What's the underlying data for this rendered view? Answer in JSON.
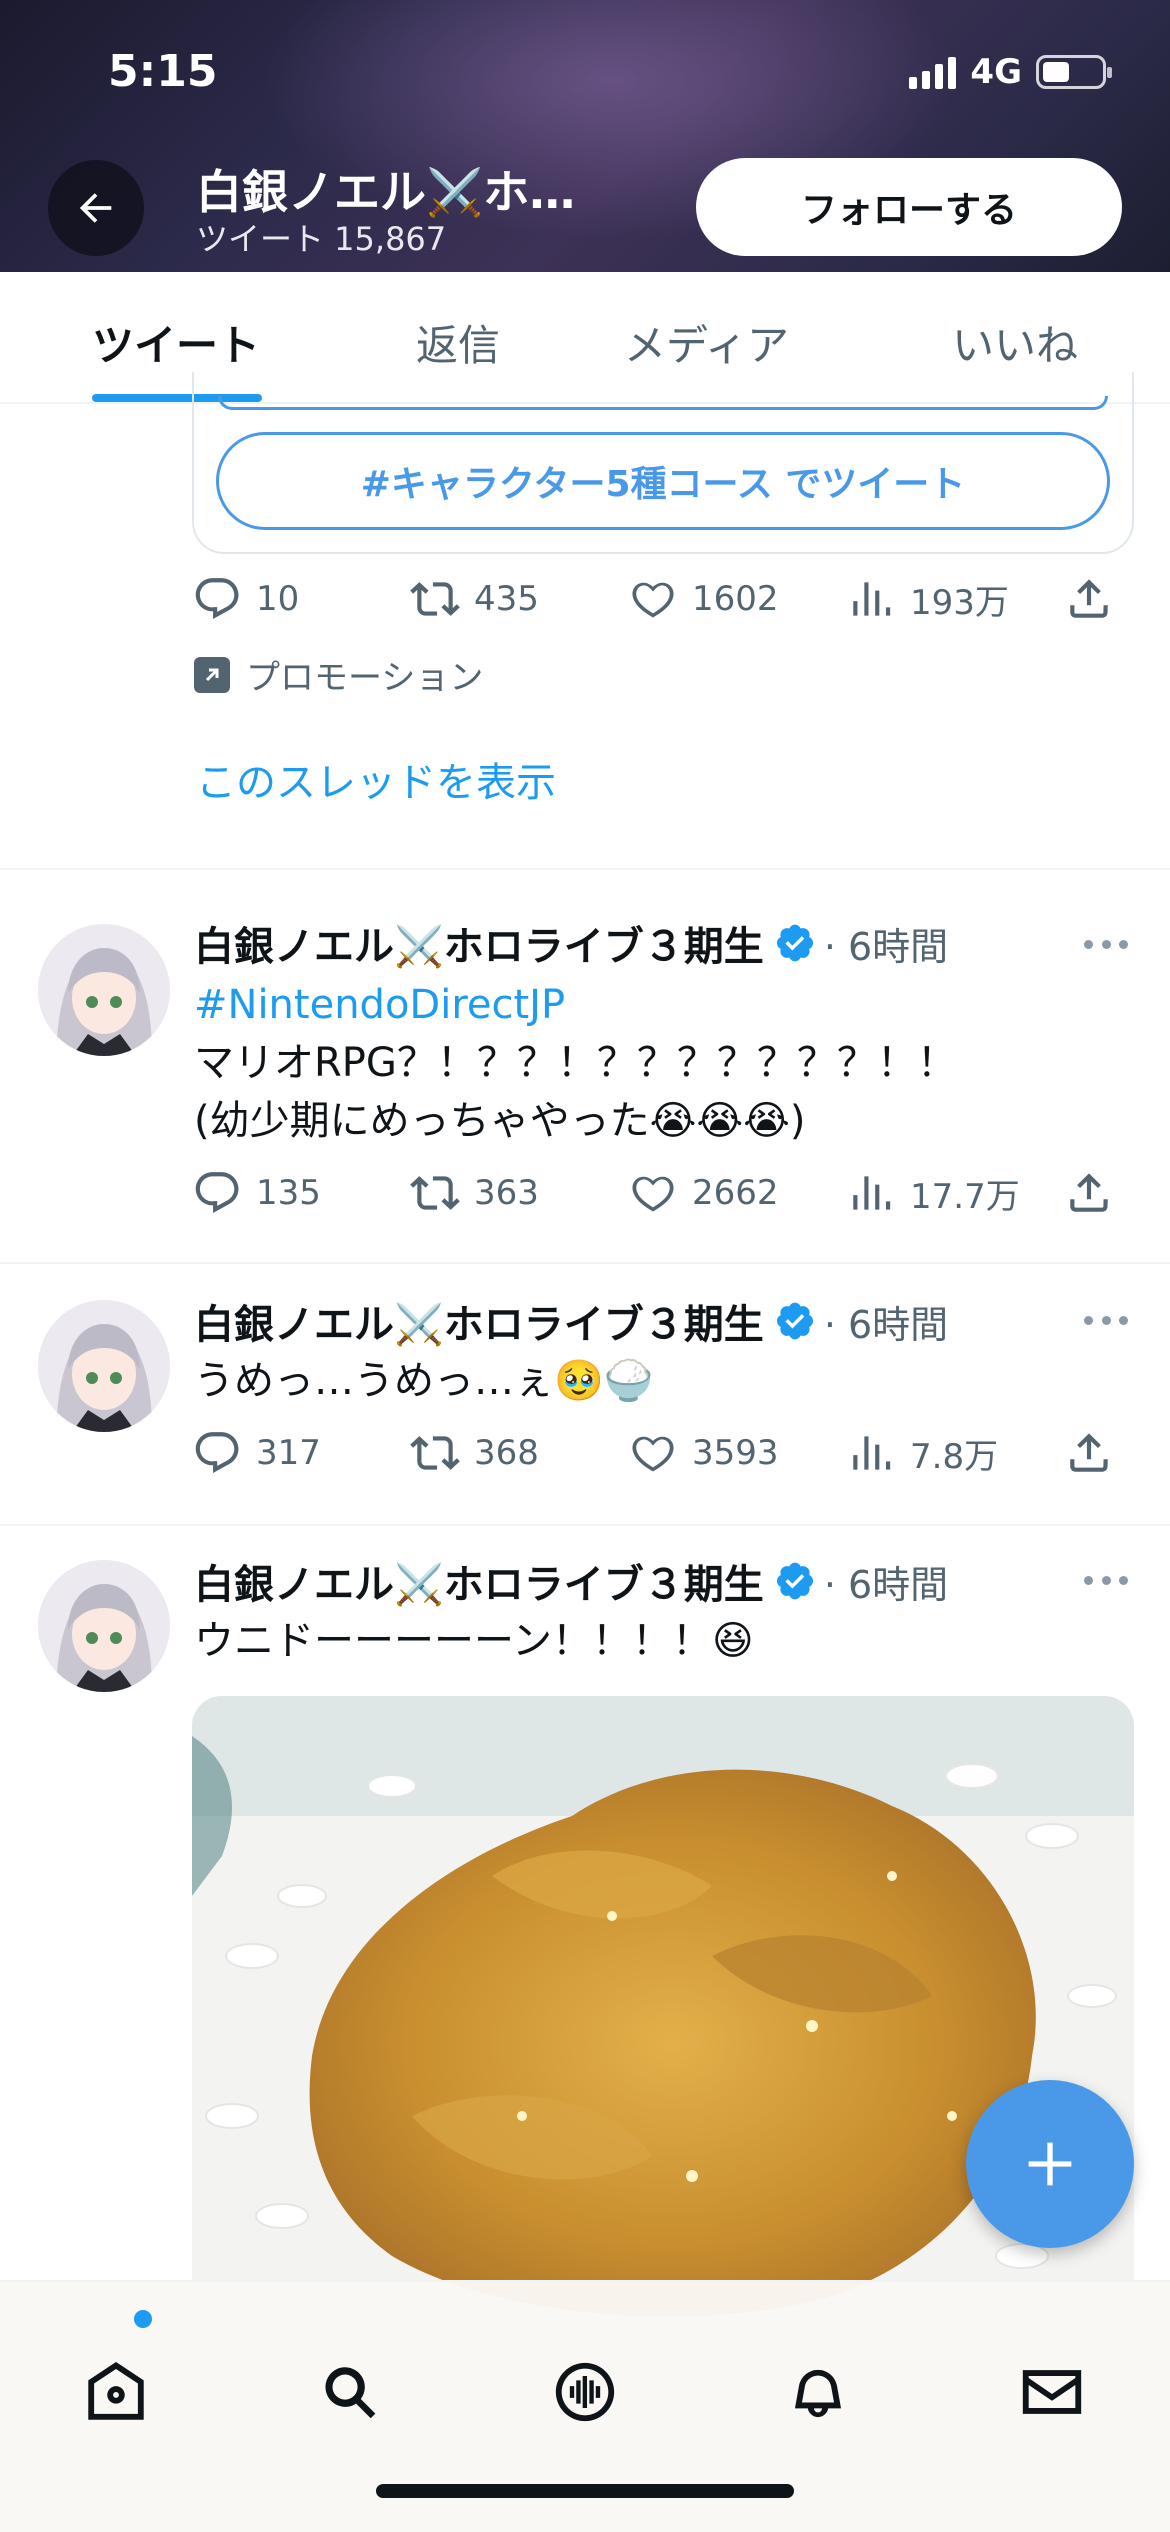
{
  "status_bar": {
    "time": "5:15",
    "network": "4G"
  },
  "header": {
    "name": "白銀ノエル⚔️ホ…",
    "tweet_count": "ツイート 15,867",
    "follow_label": "フォローする"
  },
  "tabs": [
    "ツイート",
    "返信",
    "メディア",
    "いいね"
  ],
  "promo": {
    "hashtag_button": "#キャラクター5種コース でツイート",
    "stats": {
      "replies": "10",
      "retweets": "435",
      "likes": "1602",
      "views": "193万"
    },
    "promotion_label": "プロモーション",
    "show_thread": "このスレッドを表示"
  },
  "tweets": [
    {
      "name": "白銀ノエル⚔️ホロライブ３期生",
      "time": "· 6時間",
      "hashtag": "#NintendoDirectJP",
      "line1": "マリオRPG？！？？！？？？？？？？！！",
      "line2": "(幼少期にめっちゃやった😭😭😭)",
      "stats": {
        "replies": "135",
        "retweets": "363",
        "likes": "2662",
        "views": "17.7万"
      }
    },
    {
      "name": "白銀ノエル⚔️ホロライブ３期生",
      "time": "· 6時間",
      "line1": "うめっ…うめっ…ぇ🥹🍚",
      "stats": {
        "replies": "317",
        "retweets": "368",
        "likes": "3593",
        "views": "7.8万"
      }
    },
    {
      "name": "白銀ノエル⚔️ホロライブ３期生",
      "time": "· 6時間",
      "line1": "ウニドーーーーーン！！！！😆"
    }
  ],
  "icons": {
    "back": "arrow-left-icon",
    "reply": "reply-icon",
    "retweet": "retweet-icon",
    "like": "heart-icon",
    "views": "views-icon",
    "share": "share-icon",
    "compose": "plus-icon",
    "nav": [
      "home-icon",
      "search-icon",
      "spaces-icon",
      "bell-icon",
      "mail-icon"
    ]
  },
  "colors": {
    "accent": "#1d9bf0",
    "text": "#0f1419",
    "muted": "#536471"
  }
}
